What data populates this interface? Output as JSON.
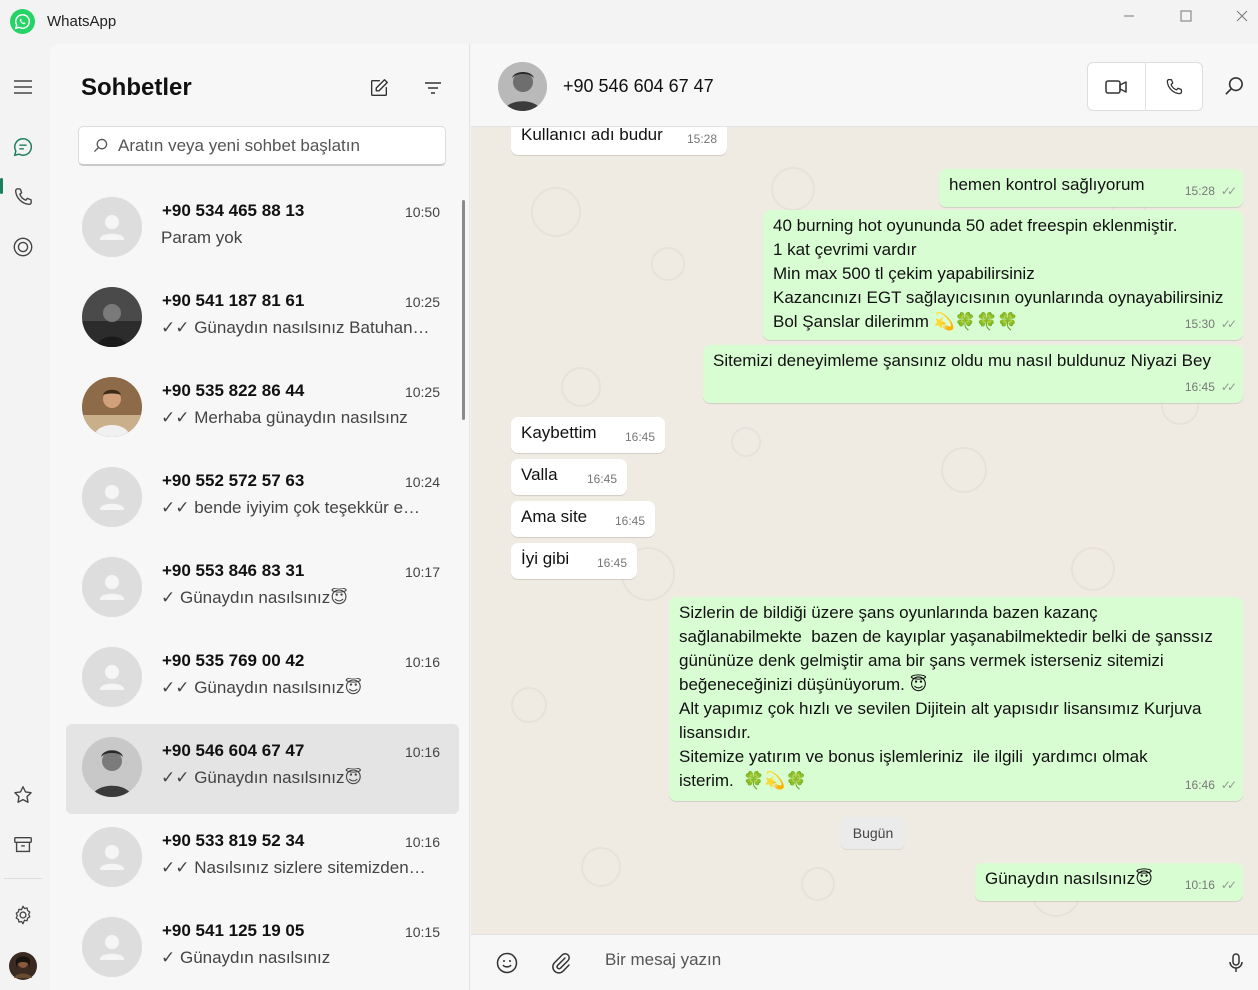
{
  "window": {
    "title": "WhatsApp",
    "controls": [
      "minimize",
      "maximize",
      "close"
    ]
  },
  "rail": {
    "top_icons": [
      "menu-icon",
      "chats-icon",
      "calls-icon",
      "status-icon"
    ],
    "bottom_icons": [
      "star-icon",
      "archive-icon",
      "settings-icon",
      "profile-avatar"
    ]
  },
  "chat_list": {
    "title": "Sohbetler",
    "search_placeholder": "Aratın veya yeni sohbet başlatın",
    "items": [
      {
        "name": "+90 534 465 88 13",
        "time": "10:50",
        "preview": "Param yok",
        "avatar": "default"
      },
      {
        "name": "+90 541 187 81 61",
        "time": "10:25",
        "preview": "✓✓ Günaydın nasılsınız Batuhan …",
        "avatar": "photo"
      },
      {
        "name": "+90 535 822 86 44",
        "time": "10:25",
        "preview": "✓✓ Merhaba günaydın nasılsınz",
        "avatar": "photo"
      },
      {
        "name": "+90 552 572 57 63",
        "time": "10:24",
        "preview": "✓✓ bende iyiyim çok teşekkür e…",
        "avatar": "default"
      },
      {
        "name": "+90 553 846 83 31",
        "time": "10:17",
        "preview": "✓ Günaydın nasılsınız😇",
        "avatar": "default"
      },
      {
        "name": "+90 535 769 00 42",
        "time": "10:16",
        "preview": "✓✓ Günaydın nasılsınız😇",
        "avatar": "default"
      },
      {
        "name": "+90 546 604 67 47",
        "time": "10:16",
        "preview": "✓✓ Günaydın nasılsınız😇",
        "avatar": "photo",
        "selected": true
      },
      {
        "name": "+90 533 819 52 34",
        "time": "10:16",
        "preview": "✓✓ Nasılsınız sizlere sitemizden…",
        "avatar": "default"
      },
      {
        "name": "+90 541 125 19 05",
        "time": "10:15",
        "preview": "✓ Günaydın nasılsınız",
        "avatar": "default"
      }
    ]
  },
  "conversation": {
    "contact_name": "+90 546 604 67 47",
    "day_divider": "Bugün",
    "composer_placeholder": "Bir mesaj yazın",
    "messages": [
      {
        "dir": "in",
        "text": "Kullanıcı adı budur",
        "time": "15:28"
      },
      {
        "dir": "out",
        "text": "hemen kontrol sağlıyorum",
        "time": "15:28"
      },
      {
        "dir": "out",
        "text": "40 burning hot oyununda 50 adet freespin eklenmiştir.\n1 kat çevrimi vardır\nMin max 500 tl çekim yapabilirsiniz\nKazancınızı EGT sağlayıcısının oyunlarında oynayabilirsiniz\nBol Şanslar dilerimm 💫🍀🍀🍀",
        "time": "15:30"
      },
      {
        "dir": "out",
        "text": "Sitemizi deneyimleme şansınız oldu mu nasıl buldunuz Niyazi Bey",
        "time": "16:45"
      },
      {
        "dir": "in",
        "text": "Kaybettim",
        "time": "16:45"
      },
      {
        "dir": "in",
        "text": "Valla",
        "time": "16:45"
      },
      {
        "dir": "in",
        "text": "Ama site",
        "time": "16:45"
      },
      {
        "dir": "in",
        "text": "İyi gibi",
        "time": "16:45"
      },
      {
        "dir": "out",
        "text": "Sizlerin de bildiği üzere şans oyunlarında bazen kazanç\nsağlanabilmekte  bazen de kayıplar yaşanabilmektedir belki de şanssız\ngününüze denk gelmiştir ama bir şans vermek isterseniz sitemizi\nbeğeneceğinizi düşünüyorum. 😇\nAlt yapımız çok hızlı ve sevilen Dijitein alt yapısıdır lisansımız Kurjuva\nlisansıdır.\nSitemize yatırım ve bonus işlemleriniz  ile ilgili  yardımcı olmak\nisterim.  🍀💫🍀",
        "time": "16:46"
      },
      {
        "dir": "out",
        "text": "Günaydın nasılsınız😇",
        "time": "10:16"
      }
    ]
  },
  "colors": {
    "brand": "#25d366",
    "outgoing_bubble": "#d9fdd3",
    "incoming_bubble": "#ffffff",
    "wallpaper": "#efeae2",
    "selected_row": "#e4e4e4"
  }
}
